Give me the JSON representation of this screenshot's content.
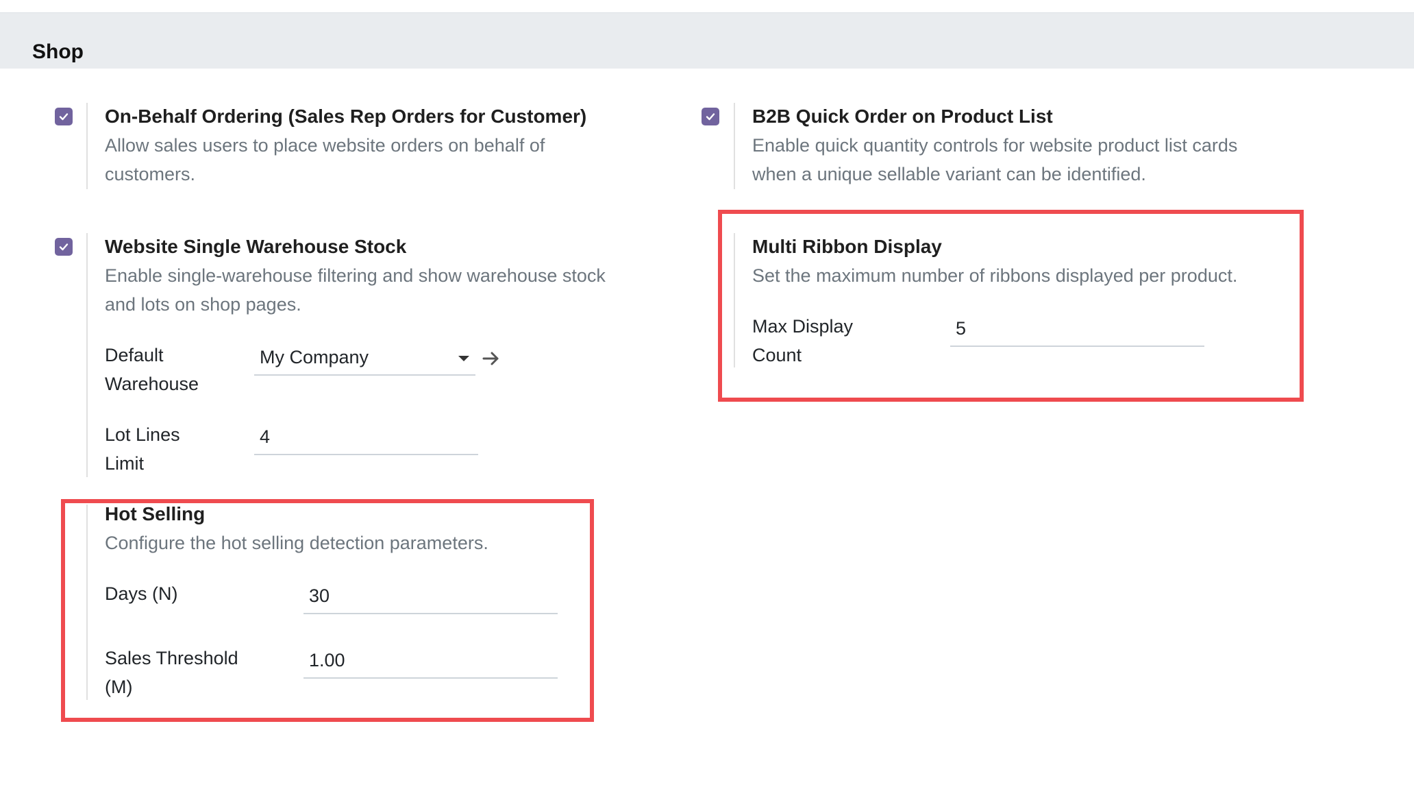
{
  "section": {
    "title": "Shop"
  },
  "settings": {
    "on_behalf": {
      "checked": true,
      "title": "On-Behalf Ordering (Sales Rep Orders for Customer)",
      "desc_line1": "Allow sales users to place website orders on behalf of",
      "desc_line2": "customers."
    },
    "b2b_quick": {
      "checked": true,
      "title": "B2B Quick Order on Product List",
      "desc_line1": "Enable quick quantity controls for website product list cards",
      "desc_line2": "when a unique sellable variant can be identified."
    },
    "single_warehouse": {
      "checked": true,
      "title": "Website Single Warehouse Stock",
      "desc_line1": "Enable single-warehouse filtering and show warehouse stock",
      "desc_line2": "and lots on shop pages.",
      "default_warehouse_label_1": "Default",
      "default_warehouse_label_2": "Warehouse",
      "default_warehouse_value": "My Company",
      "lot_lines_label_1": "Lot Lines",
      "lot_lines_label_2": "Limit",
      "lot_lines_value": "4"
    },
    "multi_ribbon": {
      "title": "Multi Ribbon Display",
      "desc": "Set the maximum number of ribbons displayed per product.",
      "max_label_1": "Max Display",
      "max_label_2": "Count",
      "max_value": "5"
    },
    "hot_selling": {
      "title": "Hot Selling",
      "desc": "Configure the hot selling detection parameters.",
      "days_label": "Days (N)",
      "days_value": "30",
      "threshold_label_1": "Sales Threshold",
      "threshold_label_2": "(M)",
      "threshold_value": "1.00"
    }
  },
  "colors": {
    "checkbox": "#71639e",
    "highlight": "#ef4b4f",
    "header_bg": "#e9ecef"
  },
  "icons": {
    "check": "check-icon",
    "dropdown": "caret-down-icon",
    "external": "arrow-right-icon"
  }
}
